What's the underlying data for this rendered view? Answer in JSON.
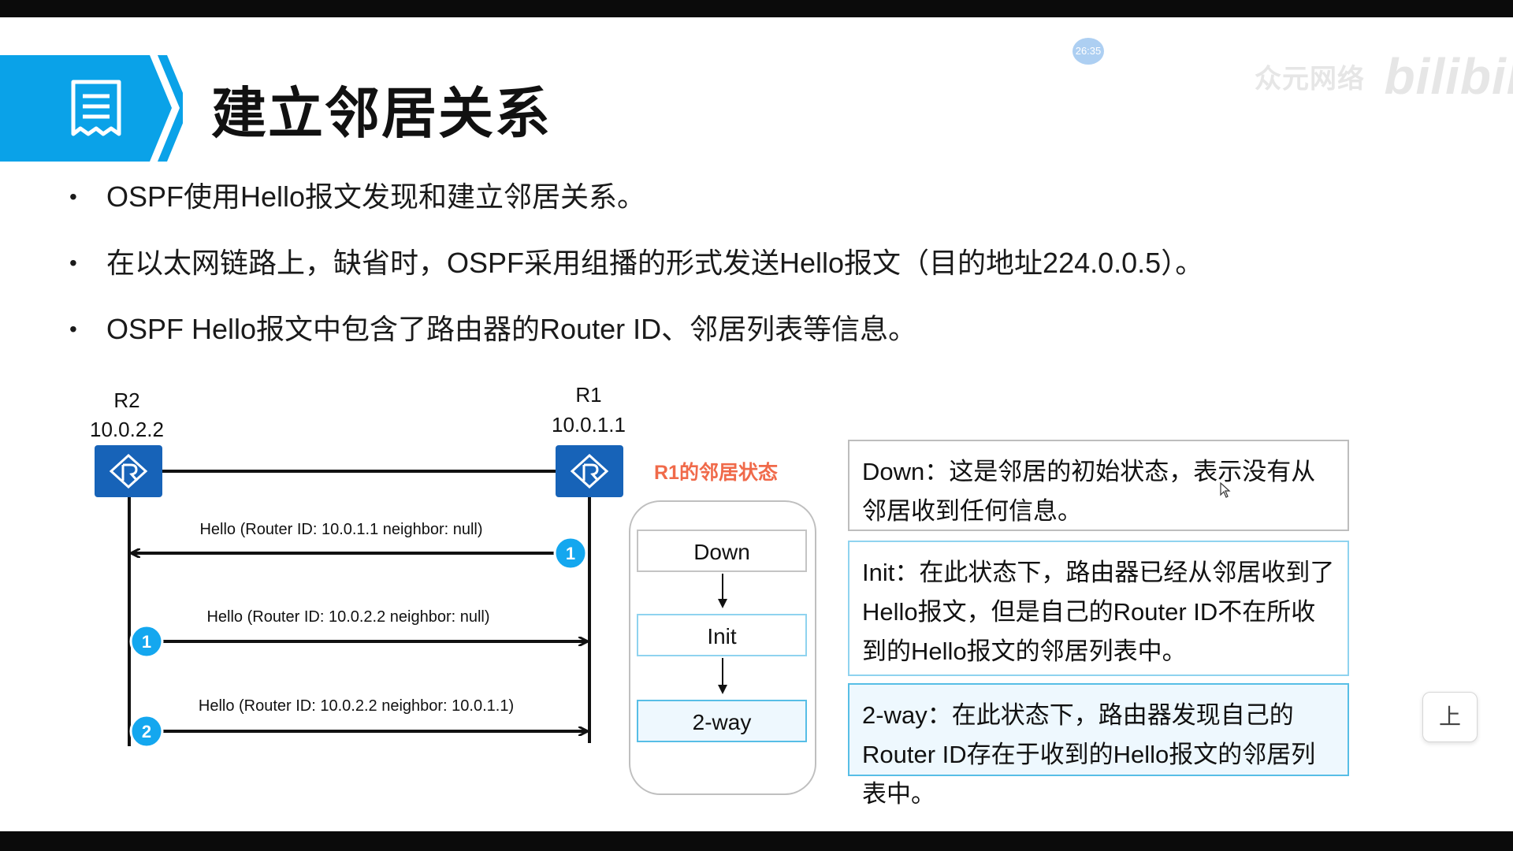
{
  "slide": {
    "title": "建立邻居关系",
    "bullets": [
      "OSPF使用Hello报文发现和建立邻居关系。",
      "在以太网链路上，缺省时，OSPF采用组播的形式发送Hello报文（目的地址224.0.0.5）。",
      "OSPF Hello报文中包含了路由器的Router ID、邻居列表等信息。"
    ]
  },
  "overlay": {
    "timestamp": "26:35",
    "watermark_author": "众元网络",
    "watermark_brand": "bilibili",
    "float_button_label": "上"
  },
  "diagram": {
    "r2": {
      "name": "R2",
      "ip": "10.0.2.2",
      "icon": "router-icon"
    },
    "r1": {
      "name": "R1",
      "ip": "10.0.1.1",
      "icon": "router-icon"
    },
    "messages": [
      {
        "text": "Hello (Router ID: 10.0.1.1 neighbor: null)",
        "step": "1",
        "direction": "r1-to-r2"
      },
      {
        "text": "Hello (Router ID: 10.0.2.2 neighbor: null)",
        "step": "1",
        "direction": "r2-to-r1"
      },
      {
        "text": "Hello (Router ID: 10.0.2.2 neighbor: 10.0.1.1)",
        "step": "2",
        "direction": "r2-to-r1"
      }
    ]
  },
  "state_panel": {
    "title": "R1的邻居状态",
    "states": [
      "Down",
      "Init",
      "2-way"
    ]
  },
  "descriptions": {
    "down": "Down：这是邻居的初始状态，表示没有从邻居收到任何信息。",
    "init": "Init：在此状态下，路由器已经从邻居收到了Hello报文，但是自己的Router ID不在所收到的Hello报文的邻居列表中。",
    "two_way": "2-way：在此状态下，路由器发现自己的Router ID存在于收到的Hello报文的邻居列表中。"
  },
  "colors": {
    "banner_blue": "#0aa2e8",
    "router_blue": "#1763b8",
    "step_badge_blue": "#14a7ef",
    "state_title_orange": "#f06a4a"
  }
}
